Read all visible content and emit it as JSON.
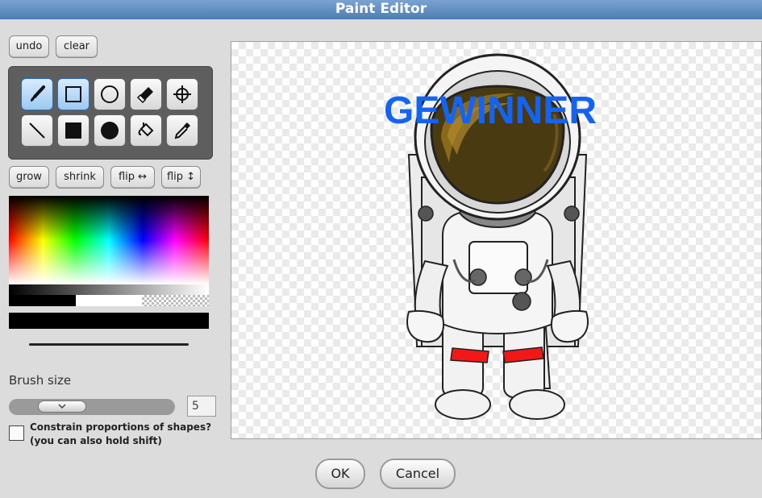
{
  "window": {
    "title": "Paint Editor"
  },
  "edit_buttons": {
    "undo": "undo",
    "clear": "clear"
  },
  "transform_buttons": {
    "grow": "grow",
    "shrink": "shrink",
    "flip_h": "flip ↔",
    "flip_v": "flip ↕"
  },
  "tools": [
    {
      "name": "brush-icon",
      "active": true
    },
    {
      "name": "rectangle-icon",
      "active": true
    },
    {
      "name": "ellipse-icon",
      "active": false
    },
    {
      "name": "eraser-icon",
      "active": false
    },
    {
      "name": "crosshair-icon",
      "active": false
    },
    {
      "name": "line-icon",
      "active": false
    },
    {
      "name": "filled-rectangle-icon",
      "active": false
    },
    {
      "name": "filled-ellipse-icon",
      "active": false
    },
    {
      "name": "paint-bucket-icon",
      "active": false
    },
    {
      "name": "eyedropper-icon",
      "active": false
    }
  ],
  "palette": {
    "current_color": "#000000",
    "swatches": [
      "#000000",
      "#ffffff",
      "transparent"
    ]
  },
  "brush": {
    "label": "Brush size",
    "value": "5"
  },
  "constrain": {
    "label_line1": "Constrain proportions of shapes?",
    "label_line2": "(you can also hold shift)",
    "checked": false
  },
  "canvas": {
    "text": "GEWINNER",
    "text_color": "#1464f4"
  },
  "dialog_buttons": {
    "ok": "OK",
    "cancel": "Cancel"
  }
}
